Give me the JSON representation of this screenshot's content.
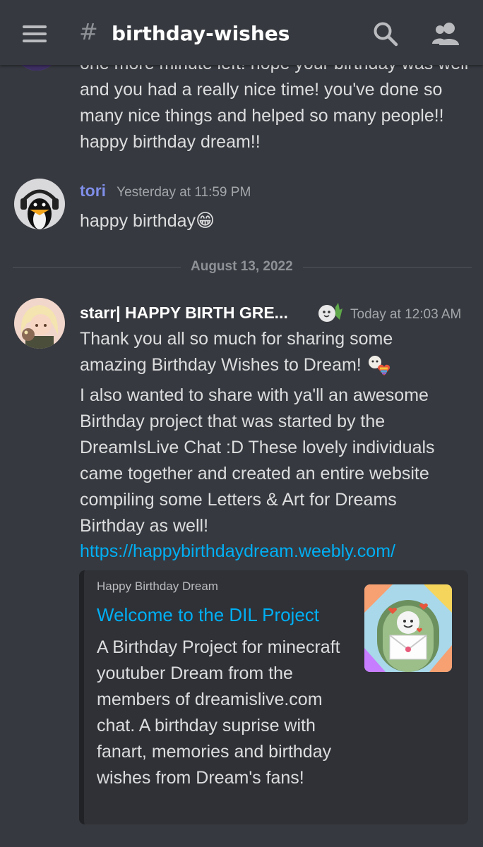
{
  "header": {
    "hash": "#",
    "channel": "birthday-wishes",
    "menu_icon": "hamburger-menu-icon",
    "search_icon": "search-icon",
    "members_icon": "members-icon"
  },
  "messages": {
    "prev_text": "one more minute left! hope your birthday was well and you had a really nice time! you've done so many nice things and helped so many people!! happy birthday dream!!",
    "tori": {
      "username": "tori",
      "timestamp": "Yesterday at 11:59 PM",
      "text": "happy birthday",
      "emoji": "😁",
      "username_color": "#7f8ee8"
    },
    "divider_date": "August 13, 2022",
    "starr": {
      "username": "starr| HAPPY BIRTH GRE...",
      "timestamp": "Today at 12:03 AM",
      "line1": "Thank you all so much for sharing some amazing Birthday Wishes to Dream!",
      "line2": "I also wanted to share with ya'll an awesome Birthday project that was started by the DreamIsLive Chat :D These lovely individuals came together and created an entire website compiling some Letters & Art for Dreams Birthday as well!",
      "link": "https://happybirthdaydream.weebly.com/",
      "username_color": "#ffffff"
    }
  },
  "embed": {
    "provider": "Happy Birthday Dream",
    "title": "Welcome to the DIL Project",
    "description": "A Birthday Project for minecraft youtuber Dream from the members of dreamislive.com chat. A birthday suprise with fanart, memories and birthday wishes from Dream's fans!"
  }
}
